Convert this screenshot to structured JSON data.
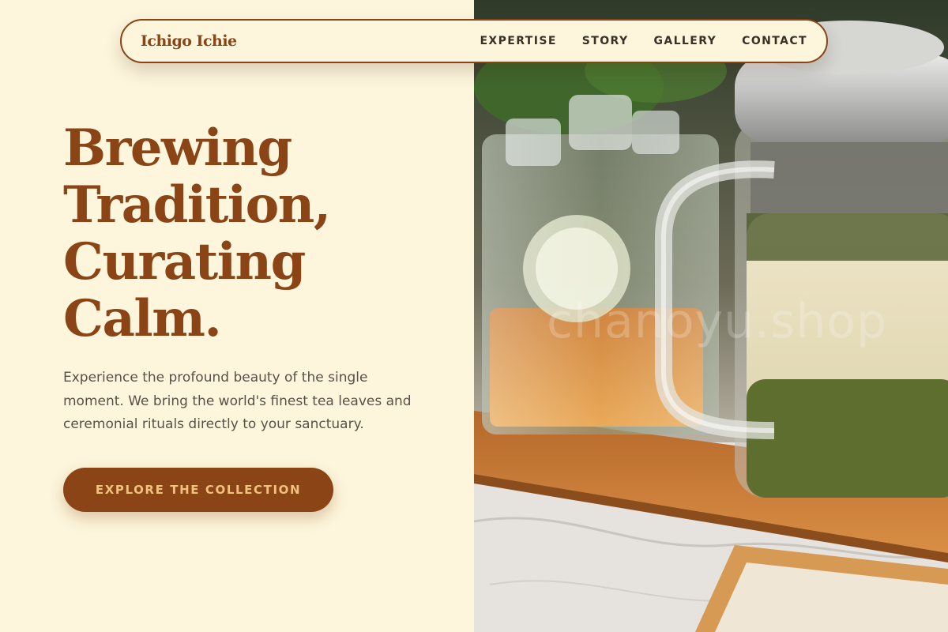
{
  "nav": {
    "brand": "Ichigo Ichie",
    "links": [
      {
        "label": "EXPERTISE"
      },
      {
        "label": "STORY"
      },
      {
        "label": "GALLERY"
      },
      {
        "label": "CONTACT"
      }
    ]
  },
  "hero": {
    "title_lines": [
      "Brewing",
      "Tradition,",
      "Curating",
      "Calm."
    ],
    "description": "Experience the profound beauty of the single moment. We bring the world's finest tea leaves and ceremonial rituals directly to your sanctuary.",
    "cta_label": "EXPLORE THE COLLECTION"
  },
  "photo": {
    "watermark": "chanoyu.shop"
  },
  "colors": {
    "background": "#fdf6dc",
    "accent": "#8a4415",
    "button_text": "#f1c27e",
    "body_text": "#5b5047",
    "nav_text": "#3c2f26"
  }
}
